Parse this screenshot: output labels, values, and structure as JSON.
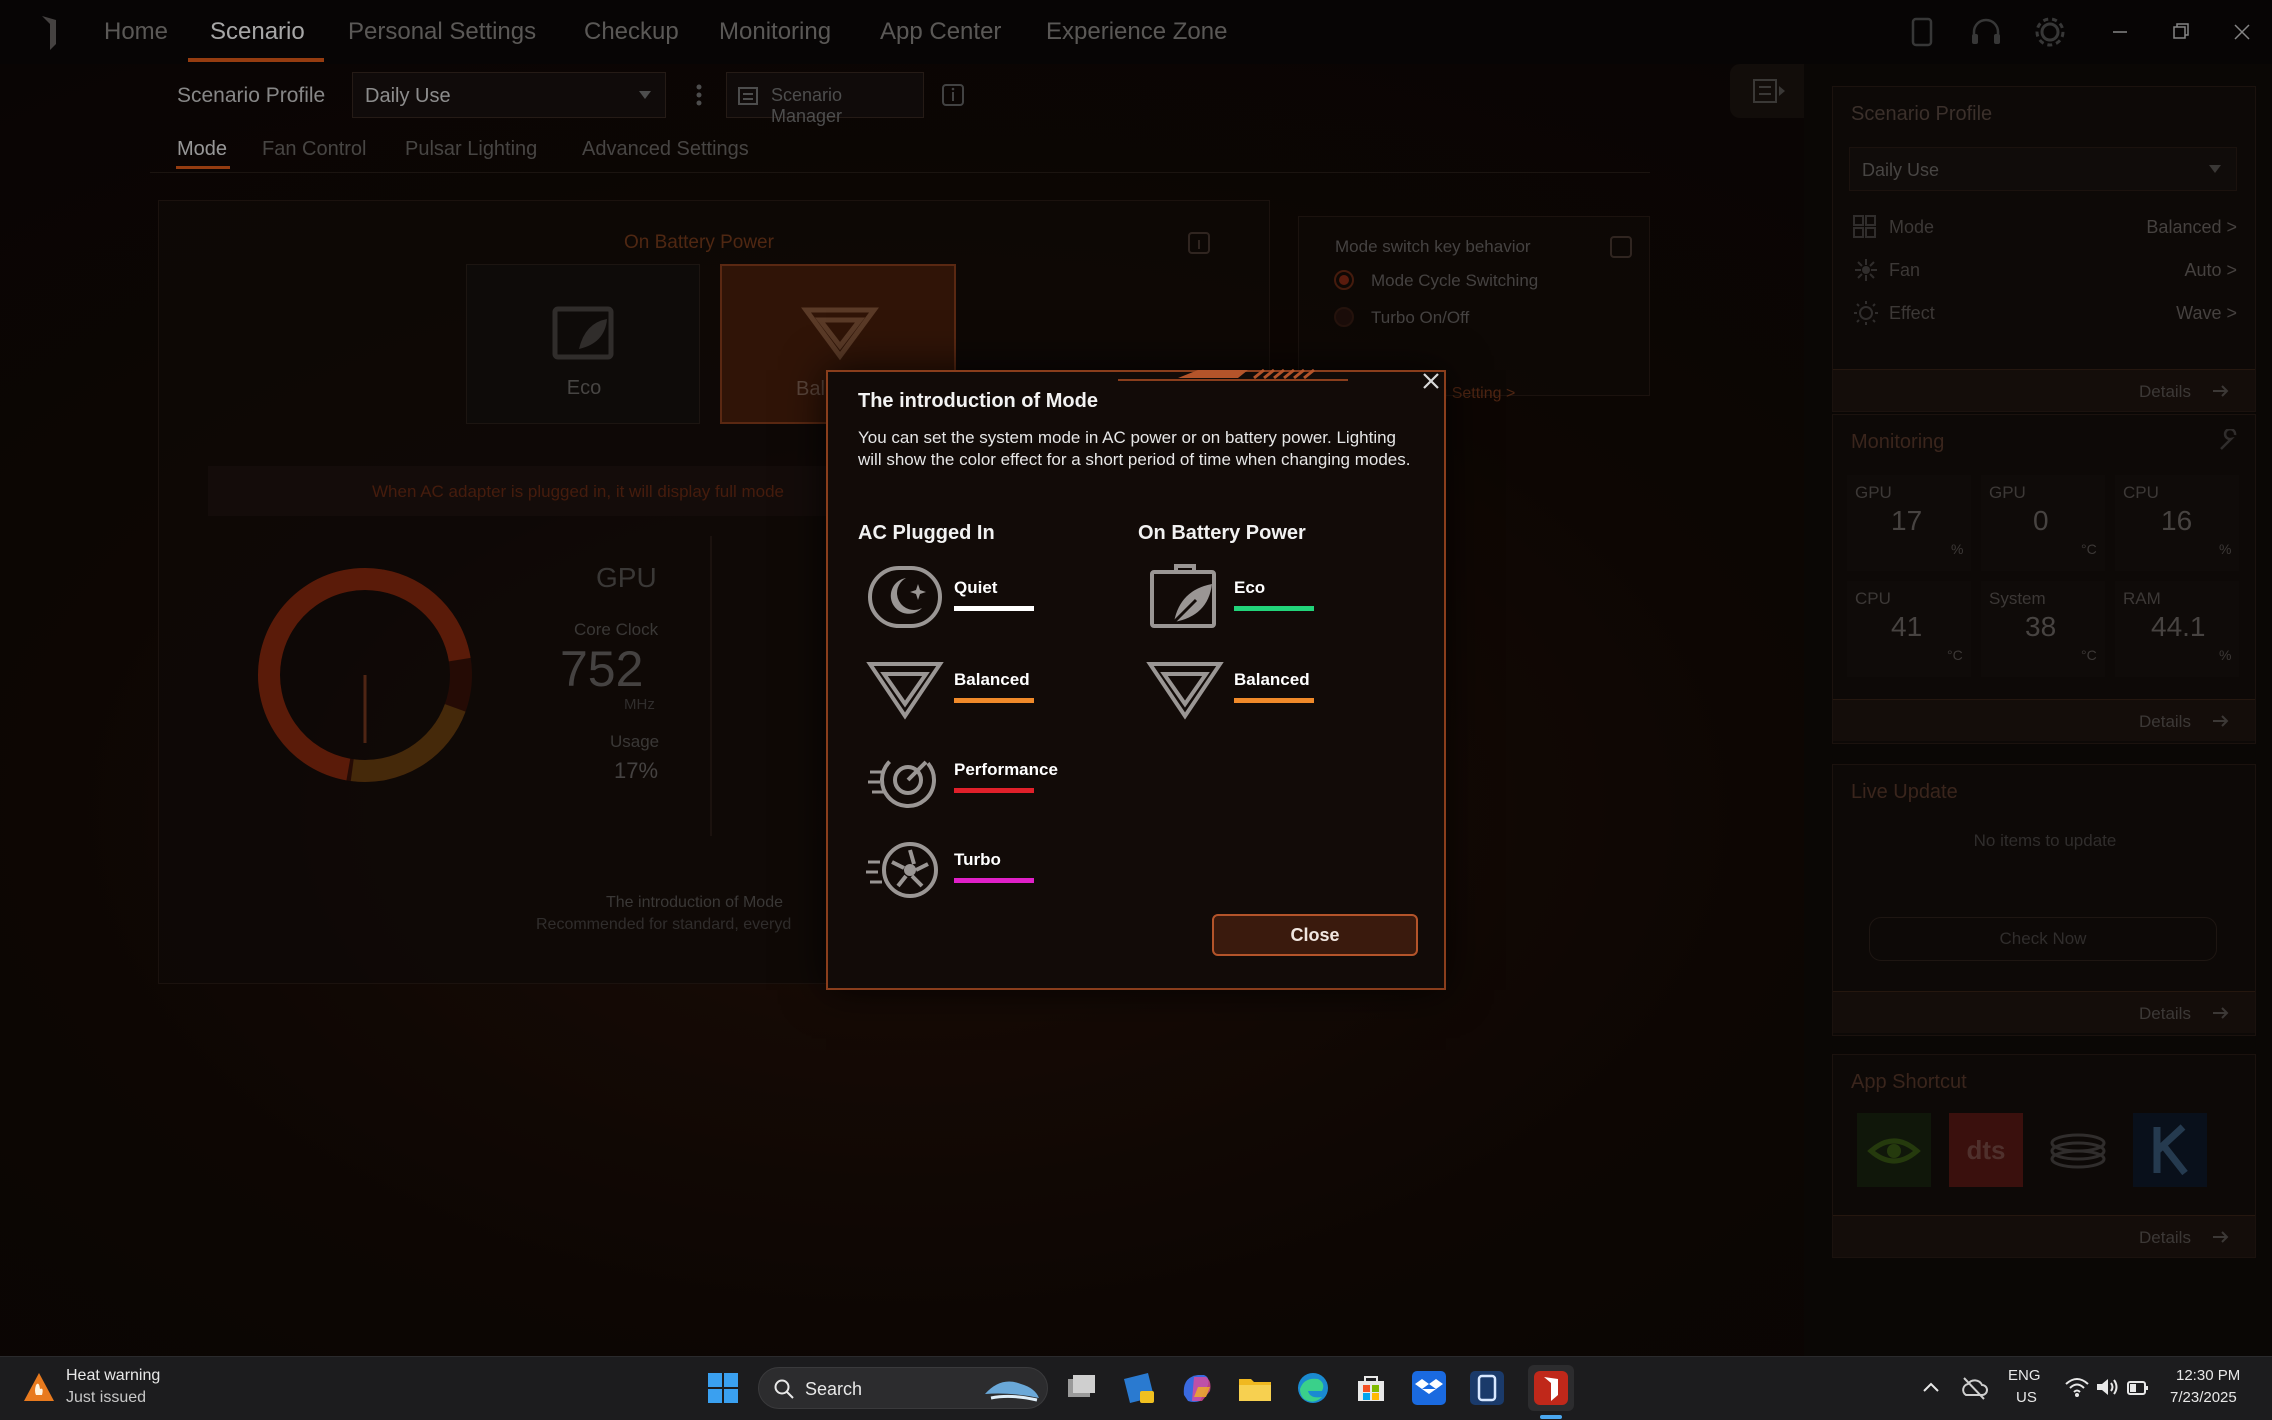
{
  "nav": {
    "tabs": [
      "Home",
      "Scenario",
      "Personal Settings",
      "Checkup",
      "Monitoring",
      "App Center",
      "Experience Zone"
    ],
    "active": "Scenario"
  },
  "scenario_bar": {
    "label": "Scenario Profile",
    "profile": "Daily Use",
    "manager": "Scenario Manager"
  },
  "subtabs": [
    "Mode",
    "Fan Control",
    "Pulsar Lighting",
    "Advanced Settings"
  ],
  "main": {
    "battery_title": "On Battery Power",
    "cards": [
      "Eco",
      "Bal"
    ],
    "ac_note": "When AC adapter is plugged in, it will display full mode",
    "gpu_title": "GPU",
    "core_clock_label": "Core Clock",
    "core_clock_value": "752",
    "core_clock_unit": "MHz",
    "usage_label": "Usage",
    "usage_value": "17%",
    "intro_label": "The introduction of Mode",
    "intro_sub": "Recommended for standard, everyd"
  },
  "mode_switch": {
    "title": "Mode switch key behavior",
    "options": [
      "Mode Cycle Switching",
      "Turbo On/Off"
    ],
    "link": "Operating Setting >"
  },
  "right": {
    "scenario_title": "Scenario Profile",
    "profile": "Daily Use",
    "rows": [
      {
        "label": "Mode",
        "value": "Balanced >"
      },
      {
        "label": "Fan",
        "value": "Auto >"
      },
      {
        "label": "Effect",
        "value": "Wave >"
      }
    ],
    "details": "Details",
    "monitoring_title": "Monitoring",
    "metrics": [
      {
        "label": "GPU",
        "value": "17",
        "unit": "%"
      },
      {
        "label": "GPU",
        "value": "0",
        "unit": "°C"
      },
      {
        "label": "CPU",
        "value": "16",
        "unit": "%"
      },
      {
        "label": "CPU",
        "value": "41",
        "unit": "°C"
      },
      {
        "label": "System",
        "value": "38",
        "unit": "°C"
      },
      {
        "label": "RAM",
        "value": "44.1",
        "unit": "%"
      }
    ],
    "live_title": "Live Update",
    "live_empty": "No items to update",
    "check_now": "Check Now",
    "shortcut_title": "App Shortcut"
  },
  "dialog": {
    "title": "The introduction of Mode",
    "description": "You can set the system mode in AC power or on battery power. Lighting will show the color effect for a short period of time when changing modes.",
    "ac_heading": "AC Plugged In",
    "battery_heading": "On Battery Power",
    "ac_modes": [
      {
        "name": "Quiet",
        "color": "#ffffff"
      },
      {
        "name": "Balanced",
        "color": "#f08a2a"
      },
      {
        "name": "Performance",
        "color": "#e0202a"
      },
      {
        "name": "Turbo",
        "color": "#e020c8"
      }
    ],
    "battery_modes": [
      {
        "name": "Eco",
        "color": "#22d47a"
      },
      {
        "name": "Balanced",
        "color": "#f08a2a"
      }
    ],
    "close": "Close"
  },
  "taskbar": {
    "notice_title": "Heat warning",
    "notice_sub": "Just issued",
    "search": "Search",
    "lang1": "ENG",
    "lang2": "US",
    "time": "12:30 PM",
    "date": "7/23/2025"
  }
}
